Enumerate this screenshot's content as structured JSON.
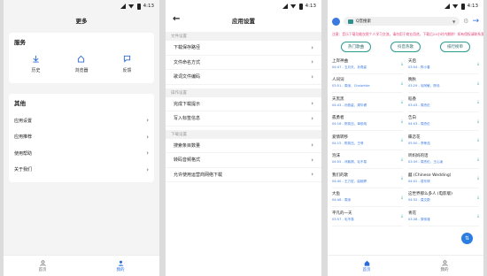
{
  "status": {
    "time": "4:13"
  },
  "p1": {
    "title": "更多",
    "services_title": "服务",
    "services": [
      {
        "label": "历史",
        "icon": "download-icon"
      },
      {
        "label": "浏览器",
        "icon": "home-icon"
      },
      {
        "label": "反馈",
        "icon": "feedback-icon"
      }
    ],
    "other_title": "其他",
    "rows": [
      "应用设置",
      "应用推荐",
      "使用帮助",
      "关于我们"
    ]
  },
  "p2": {
    "title": "应用设置",
    "sections": [
      {
        "header": "文件设置",
        "items": [
          "下载保存路径",
          "文件命名方式",
          "歌词文件编码"
        ]
      },
      {
        "header": "操作设置",
        "items": [
          "完成下载提示",
          "写入标签信息"
        ]
      },
      {
        "header": "下载设置",
        "items": [
          "搜索条目数量",
          "转码音频格式",
          "允许使用运营商网络下载"
        ]
      }
    ]
  },
  "p3": {
    "select_label": "Q音搜索",
    "marquee": "注意：音乐下载功能仅限个人学习交流，请勿用于商业用途，下载后24小时内删除！如有侵权请联系我们。",
    "buttons": [
      "热门歌曲",
      "抖音热歌",
      "排行榜单"
    ],
    "songs": [
      {
        "name": "上岸神曲",
        "artist": "04:47 - 五月天、孙燕姿"
      },
      {
        "name": "天后",
        "artist": "03:54 - 陈小春"
      },
      {
        "name": "人间词",
        "artist": "03:51 - 周深、Chaiwhite"
      },
      {
        "name": "晚秋",
        "artist": "03:29 - 毛阿敏、陈伟"
      },
      {
        "name": "天黑黑",
        "artist": "04:43 - 孙燕姿、周华健"
      },
      {
        "name": "稻香",
        "artist": "03:43 - 周杰伦"
      },
      {
        "name": "孤勇者",
        "artist": "04:16 - 陈奕迅、单依纯"
      },
      {
        "name": "告白",
        "artist": "04:03 - 周杰伦"
      },
      {
        "name": "爱情转移",
        "artist": "04:15 - 陈奕迅、王菲"
      },
      {
        "name": "蝶恋花",
        "artist": "05:50 - 李荣浩"
      },
      {
        "name": "泡沫",
        "artist": "04:05 - 邓紫棋、毛不易"
      },
      {
        "name": "听妈妈的话",
        "artist": "03:39 - 周杰伦、王心凌"
      },
      {
        "name": "我们的歌",
        "artist": "04:40 - 王力宏、曲婉婷"
      },
      {
        "name": "囍 (Chinese Wedding)",
        "artist": "04:02 - 葛东琪"
      },
      {
        "name": "大鱼",
        "artist": "04:48 - 周深"
      },
      {
        "name": "这世界那么多人 (电影版)",
        "artist": "04:32 - 莫文蔚"
      },
      {
        "name": "平凡的一天",
        "artist": "03:57 - 毛不易"
      },
      {
        "name": "青花",
        "artist": "03:38 - 周传雄"
      }
    ],
    "fab": "⇅"
  },
  "nav": {
    "home": "首页",
    "mine": "我的"
  }
}
